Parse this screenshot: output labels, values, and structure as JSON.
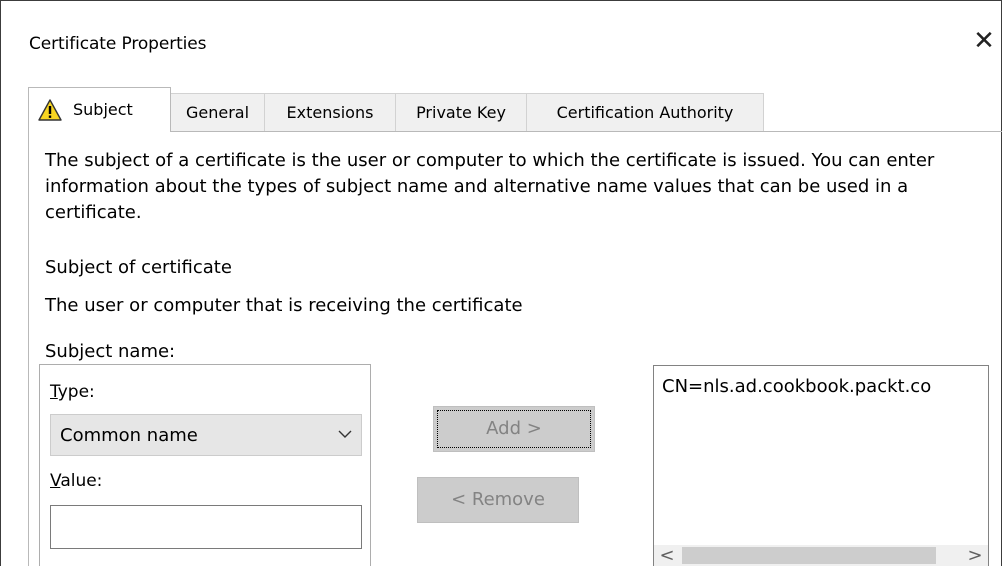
{
  "dialog": {
    "title": "Certificate Properties",
    "close_glyph": "✕"
  },
  "tabs": [
    {
      "label": "Subject",
      "active": true,
      "icon": "warning-icon"
    },
    {
      "label": "General",
      "active": false
    },
    {
      "label": "Extensions",
      "active": false
    },
    {
      "label": "Private Key",
      "active": false
    },
    {
      "label": "Certification Authority",
      "active": false
    }
  ],
  "subject_tab": {
    "description": "The subject of a certificate is the user or computer to which the certificate is issued. You can enter information about the types of subject name and alternative name values that can be used in a certificate.",
    "section_heading": "Subject of certificate",
    "section_subtext": "The user or computer that is receiving the certificate",
    "subject_name_label": "Subject name:",
    "type_label_accel": "T",
    "type_label_rest": "ype:",
    "type_value": "Common name",
    "value_label_accel": "V",
    "value_label_rest": "alue:",
    "value_input": "",
    "add_button": "Add >",
    "remove_button": "< Remove",
    "subject_list": [
      "CN=nls.ad.cookbook.packt.co"
    ],
    "scroll_left": "<",
    "scroll_right": ">"
  },
  "colors": {
    "warning_fill": "#f8d521",
    "disabled_button": "#cccccc",
    "disabled_text": "#838383"
  }
}
